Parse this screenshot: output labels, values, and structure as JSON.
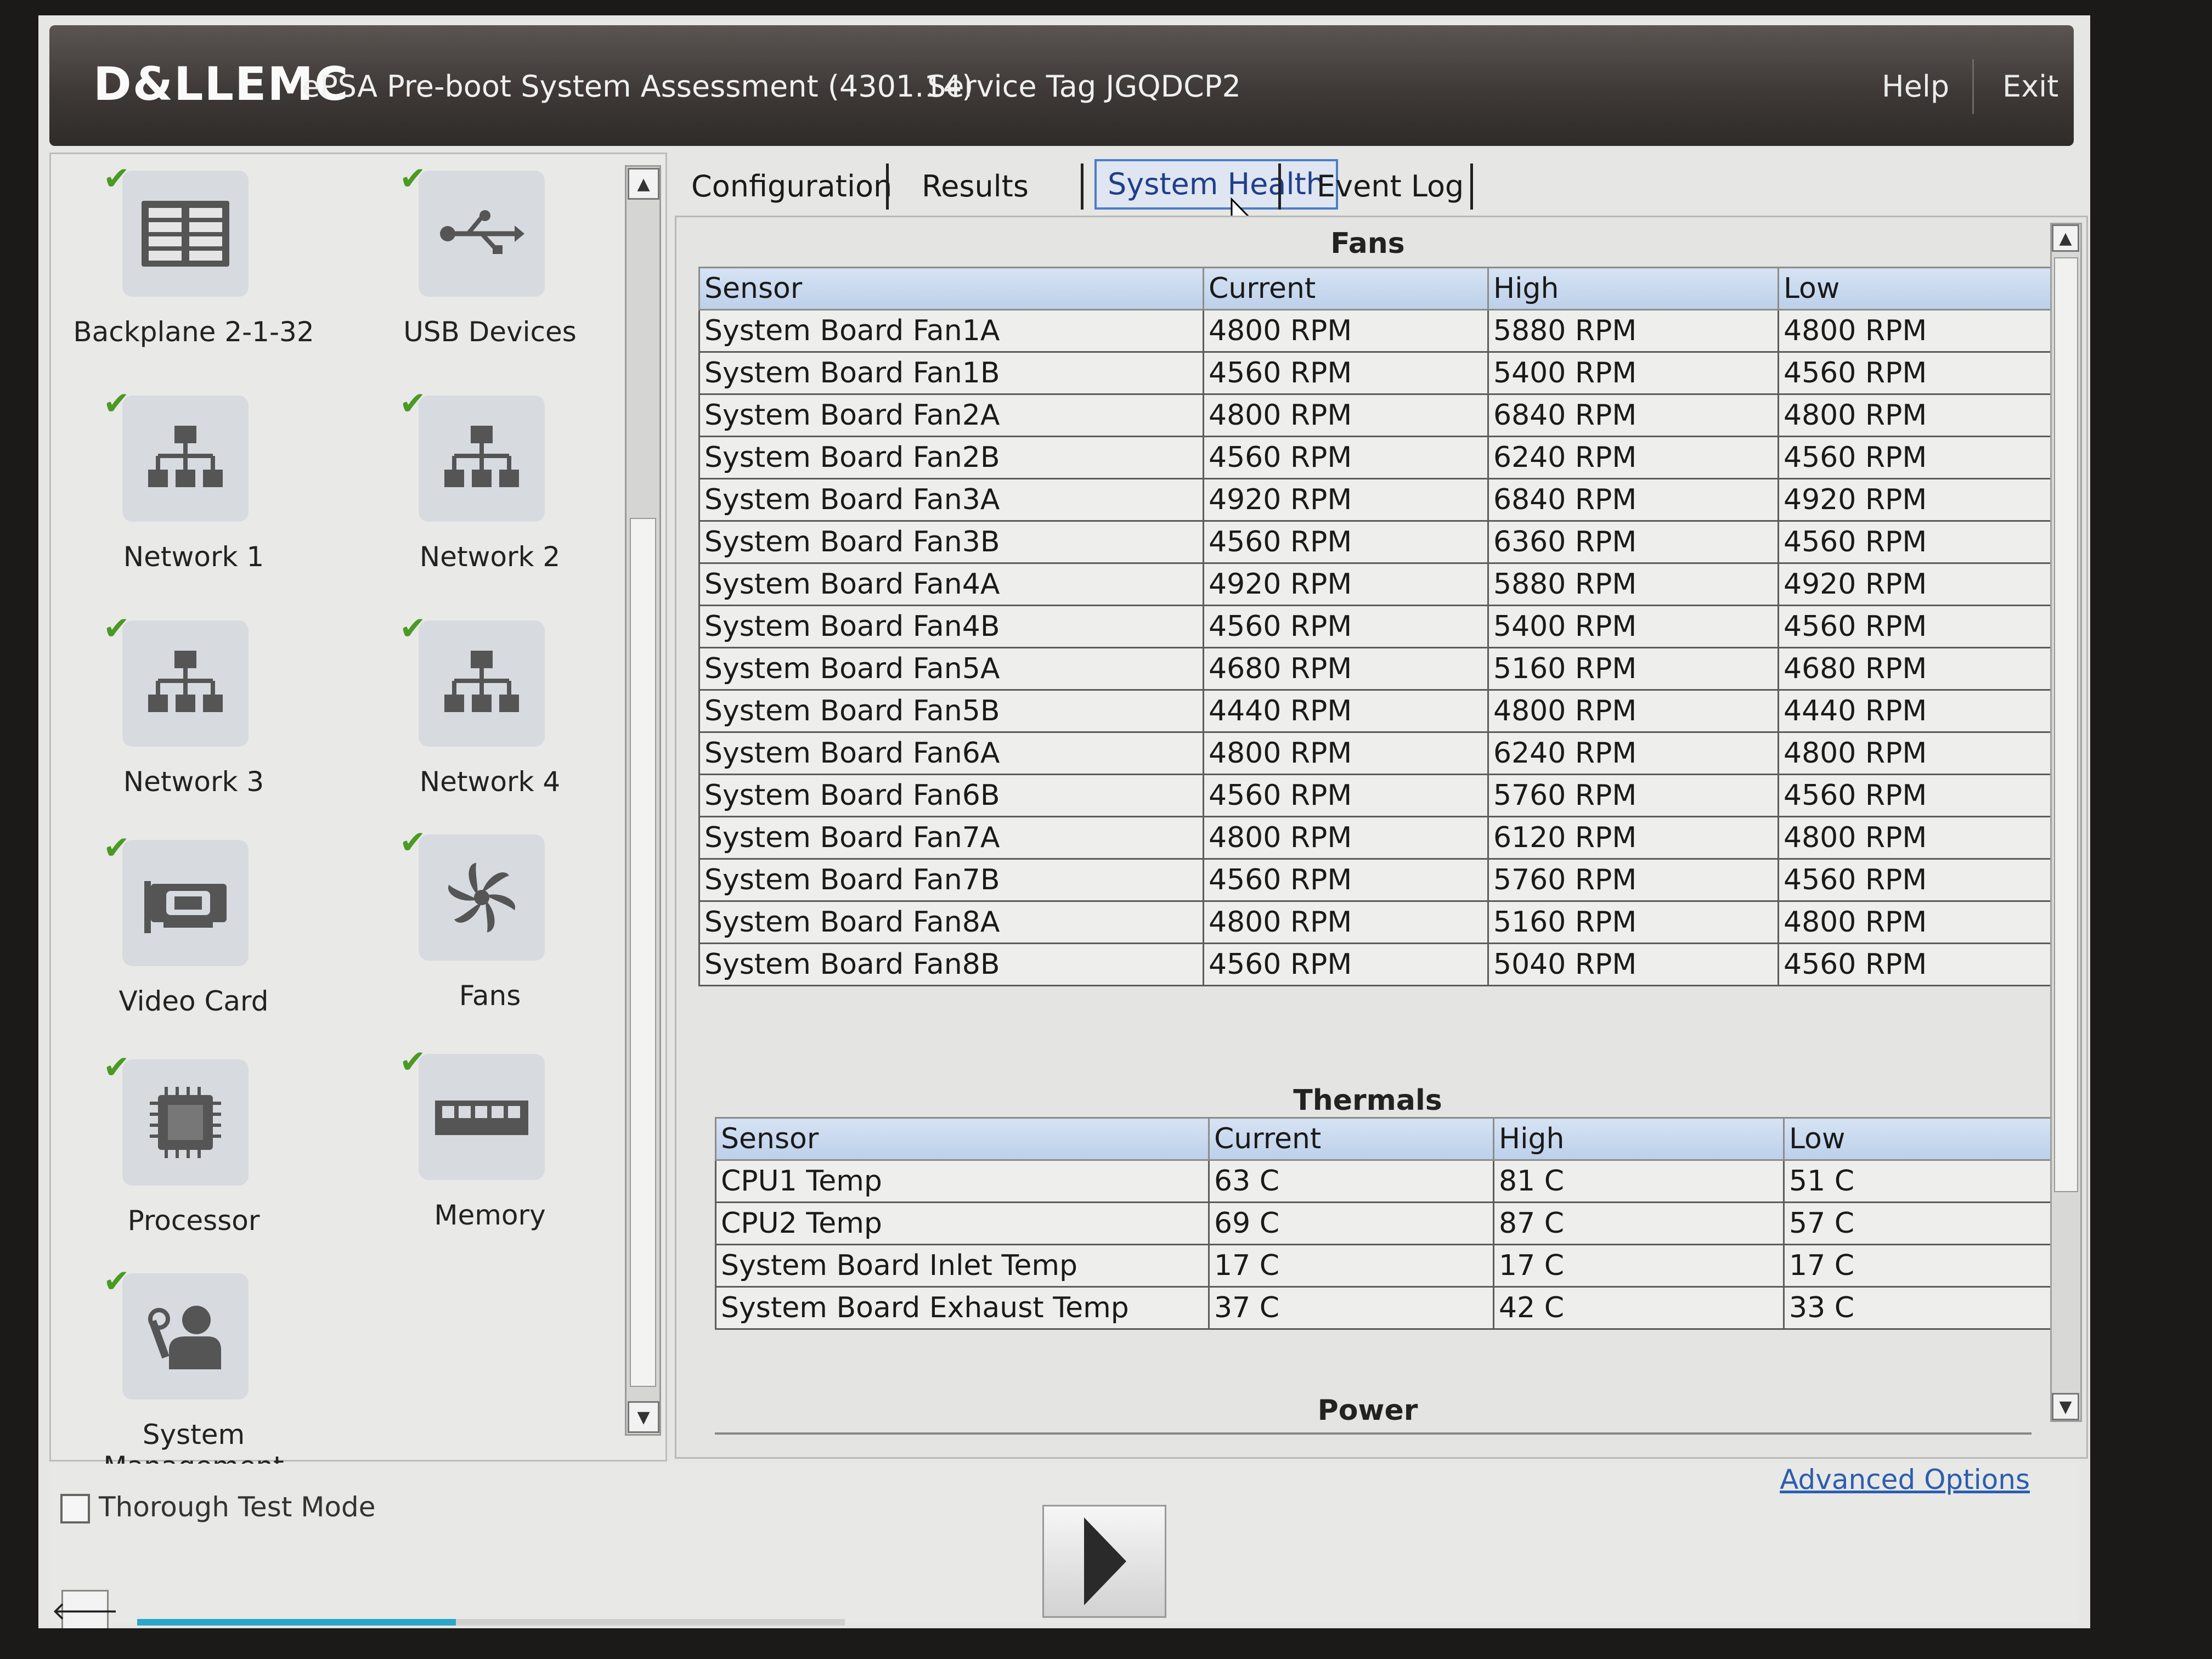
{
  "header": {
    "logo": "D&LLEMC",
    "title": "ePSA Pre-boot System Assessment (4301.14)",
    "service_tag": "Service Tag JGQDCP2",
    "help": "Help",
    "exit": "Exit"
  },
  "devices": [
    {
      "label": "Backplane 2-1-32",
      "icon": "backplane-icon"
    },
    {
      "label": "USB Devices",
      "icon": "usb-icon"
    },
    {
      "label": "Network 1",
      "icon": "network-icon"
    },
    {
      "label": "Network 2",
      "icon": "network-icon"
    },
    {
      "label": "Network 3",
      "icon": "network-icon"
    },
    {
      "label": "Network 4",
      "icon": "network-icon"
    },
    {
      "label": "Video Card",
      "icon": "video-card-icon"
    },
    {
      "label": "Fans",
      "icon": "fan-icon"
    },
    {
      "label": "Processor",
      "icon": "processor-icon"
    },
    {
      "label": "Memory",
      "icon": "memory-icon"
    },
    {
      "label": "System Management",
      "icon": "system-management-icon"
    }
  ],
  "tabs": [
    "Configuration",
    "Results",
    "System Health",
    "Event Log"
  ],
  "active_tab": "System Health",
  "fans": {
    "title": "Fans",
    "columns": [
      "Sensor",
      "Current",
      "High",
      "Low"
    ],
    "rows": [
      [
        "System Board Fan1A",
        "4800 RPM",
        "5880 RPM",
        "4800 RPM"
      ],
      [
        "System Board Fan1B",
        "4560 RPM",
        "5400 RPM",
        "4560 RPM"
      ],
      [
        "System Board Fan2A",
        "4800 RPM",
        "6840 RPM",
        "4800 RPM"
      ],
      [
        "System Board Fan2B",
        "4560 RPM",
        "6240 RPM",
        "4560 RPM"
      ],
      [
        "System Board Fan3A",
        "4920 RPM",
        "6840 RPM",
        "4920 RPM"
      ],
      [
        "System Board Fan3B",
        "4560 RPM",
        "6360 RPM",
        "4560 RPM"
      ],
      [
        "System Board Fan4A",
        "4920 RPM",
        "5880 RPM",
        "4920 RPM"
      ],
      [
        "System Board Fan4B",
        "4560 RPM",
        "5400 RPM",
        "4560 RPM"
      ],
      [
        "System Board Fan5A",
        "4680 RPM",
        "5160 RPM",
        "4680 RPM"
      ],
      [
        "System Board Fan5B",
        "4440 RPM",
        "4800 RPM",
        "4440 RPM"
      ],
      [
        "System Board Fan6A",
        "4800 RPM",
        "6240 RPM",
        "4800 RPM"
      ],
      [
        "System Board Fan6B",
        "4560 RPM",
        "5760 RPM",
        "4560 RPM"
      ],
      [
        "System Board Fan7A",
        "4800 RPM",
        "6120 RPM",
        "4800 RPM"
      ],
      [
        "System Board Fan7B",
        "4560 RPM",
        "5760 RPM",
        "4560 RPM"
      ],
      [
        "System Board Fan8A",
        "4800 RPM",
        "5160 RPM",
        "4800 RPM"
      ],
      [
        "System Board Fan8B",
        "4560 RPM",
        "5040 RPM",
        "4560 RPM"
      ]
    ]
  },
  "thermals": {
    "title": "Thermals",
    "columns": [
      "Sensor",
      "Current",
      "High",
      "Low"
    ],
    "rows": [
      [
        "CPU1 Temp",
        "63 C",
        "81 C",
        "51 C"
      ],
      [
        "CPU2 Temp",
        "69 C",
        "87 C",
        "57 C"
      ],
      [
        "System Board Inlet Temp",
        "17 C",
        "17 C",
        "17 C"
      ],
      [
        "System Board Exhaust Temp",
        "37 C",
        "42 C",
        "33 C"
      ]
    ]
  },
  "power": {
    "title": "Power"
  },
  "footer": {
    "thorough_test_mode": "Thorough Test Mode",
    "advanced_options": "Advanced Options",
    "progress_fraction": 0.45
  },
  "colors": {
    "check": "#4a9a24",
    "progress": "#2aa7c9",
    "active_tab_border": "#4c7dc6",
    "link": "#2c5db0"
  }
}
